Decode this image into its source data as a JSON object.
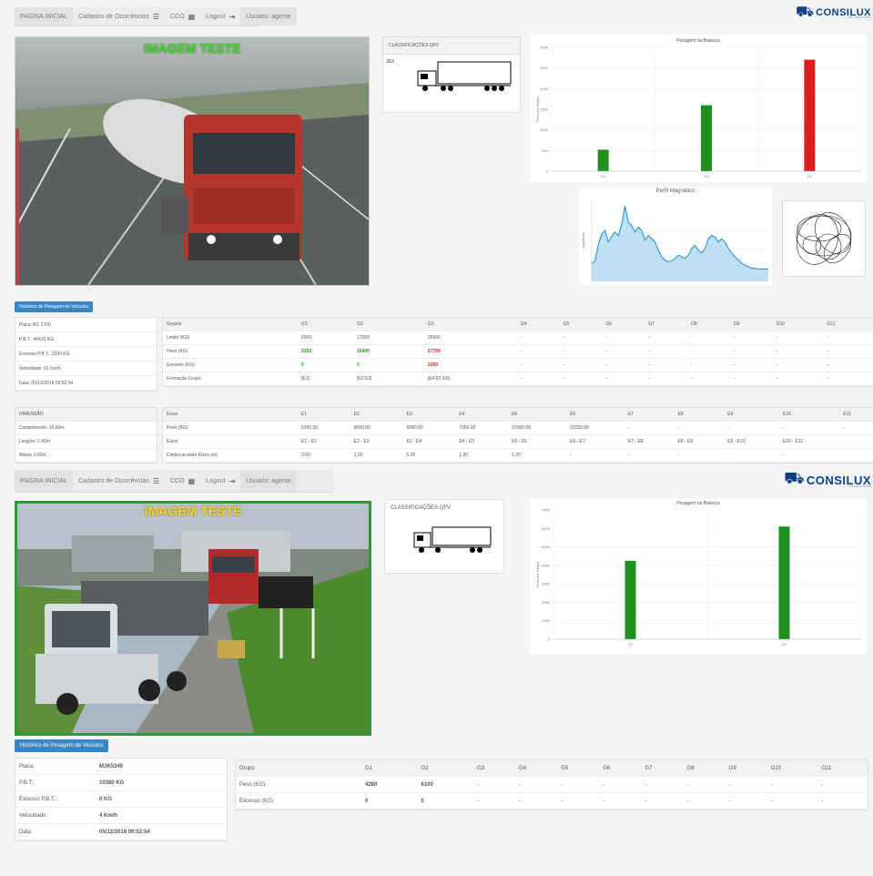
{
  "panels": [
    {
      "nav": {
        "home": "PAGINA INICIAL",
        "occurrences": "Cadastro de Ocorrências",
        "cco": "CCO",
        "logout": "Logout",
        "user": "Usuário: agente"
      },
      "logo": {
        "word": "CONSILUX",
        "tagline": "TECNOLOGIA"
      },
      "camera_title": "IMAGEM TESTE",
      "classification": {
        "label": "CLASSIFICAÇÕES QFV",
        "code": "3S3"
      },
      "weighing_chart": {
        "type": "bar",
        "title": "Pesagem na Balança",
        "ylabel": "Peso por Grupo",
        "categories": [
          "G1",
          "G2",
          "G3"
        ],
        "values": [
          520,
          1600,
          2700
        ],
        "colors": [
          "#1f8f1f",
          "#1f8f1f",
          "#e01d1d"
        ],
        "ylim": [
          0,
          3000
        ],
        "yticks": [
          "0",
          "500",
          "1000",
          "1500",
          "2000",
          "2500",
          "3000"
        ]
      },
      "magnetic_chart": {
        "type": "area",
        "title": "Perfil Magnético",
        "ylabel": "Amplitude",
        "values": [
          22,
          25,
          45,
          58,
          62,
          48,
          55,
          60,
          56,
          70,
          92,
          72,
          68,
          60,
          66,
          62,
          50,
          56,
          52,
          48,
          38,
          30,
          26,
          24,
          25,
          28,
          32,
          30,
          28,
          32,
          40,
          44,
          38,
          35,
          40,
          52,
          56,
          54,
          48,
          52,
          48,
          40,
          35,
          30,
          26,
          22,
          20,
          18,
          16,
          16,
          15,
          15,
          15,
          15
        ]
      },
      "history_button": "Histórico de Pesagem de Veículos",
      "vehicle_info": [
        "Placa: BC 1700",
        "P.B.T.: 40410 KG",
        "Excesso P.B.T.: 2200 KG",
        "Velocidade: 61 Km/h",
        "Data: 05/12/2018 09:52:34"
      ],
      "groups_table": {
        "headers": [
          "Grupos",
          "G1",
          "G2",
          "G3",
          "G4",
          "G5",
          "G6",
          "G7",
          "G8",
          "G9",
          "G10",
          "G11"
        ],
        "rows": [
          {
            "label": "Limite (KG)",
            "cells": [
              "6000",
              "17000",
              "25500",
              "-",
              "-",
              "-",
              "-",
              "-",
              "-",
              "-",
              "-"
            ]
          },
          {
            "label": "Peso (KG)",
            "cells": [
              "5250",
              "15400",
              "27700",
              "-",
              "-",
              "-",
              "-",
              "-",
              "-",
              "-",
              "-"
            ]
          },
          {
            "label": "Excesso (KG)",
            "cells": [
              "0",
              "0",
              "2200",
              "-",
              "-",
              "-",
              "-",
              "-",
              "-",
              "-",
              "-"
            ]
          },
          {
            "label": "Formação Grupo",
            "cells": [
              "[E1]",
              "[E2 E3]",
              "[E4 E5 E6]",
              "-",
              "-",
              "-",
              "-",
              "-",
              "-",
              "-",
              "-"
            ]
          }
        ]
      },
      "dimension_info": {
        "title": "DIMENSÃO",
        "rows": [
          "Comprimento: 18.60m",
          "Largura: 2.45m",
          "Altura: 3.60m"
        ]
      },
      "axles_table": {
        "headers": [
          "Eixos",
          "E1",
          "E2",
          "E3",
          "E4",
          "E5",
          "E6",
          "E7",
          "E8",
          "E9",
          "E10",
          "E11"
        ],
        "rows": [
          {
            "label": "Peso (KG)",
            "cells": [
              "5250.00",
              "9060.00",
              "6080.00",
              "7060.00",
              "10360.00",
              "10250.00",
              "-",
              "-",
              "-",
              "-",
              "-"
            ]
          },
          {
            "label": "Eixos",
            "cells": [
              "E1 - E2",
              "E2 - E3",
              "E3 - E4",
              "E4 - E5",
              "E5 - E6",
              "E6 - E7",
              "E7 - E8",
              "E8 - E9",
              "E9 - E10",
              "E10 - E11",
              ""
            ]
          },
          {
            "label": "Distância entre Eixos (m)",
            "cells": [
              "3.60",
              "1.30",
              "5.30",
              "1.20",
              "1.20",
              "-",
              "-",
              "-",
              "-",
              "-",
              ""
            ]
          }
        ]
      }
    },
    {
      "nav": {
        "home": "PAGINA INICIAL",
        "occurrences": "Cadastro de Ocorrências",
        "cco": "CCO",
        "logout": "Logout",
        "user": "Usuário: agente"
      },
      "logo": {
        "word": "CONSILUX",
        "tagline": "TECNOLOGIA"
      },
      "camera_title": "IMAGEM TESTE",
      "classification": {
        "label": "CLASSIFICAÇÕES QFV",
        "code": ""
      },
      "weighing_chart": {
        "type": "bar",
        "title": "Pesagem na Balança",
        "ylabel": "Peso por Grupo",
        "categories": [
          "G1",
          "G2"
        ],
        "values": [
          4250,
          6100
        ],
        "colors": [
          "#1f8f1f",
          "#1f8f1f"
        ],
        "ylim": [
          0,
          7000
        ],
        "yticks": [
          "0",
          "1000",
          "2000",
          "3000",
          "4000",
          "5000",
          "6000",
          "7000"
        ]
      },
      "history_button": "Histórico de Pesagem de Veículos",
      "vehicle_info": [
        {
          "label": "Placa:",
          "value": "MJK5349"
        },
        {
          "label": "P.B.T.:",
          "value": "10380 KG"
        },
        {
          "label": "Excesso P.B.T.:",
          "value": "0 KG"
        },
        {
          "label": "Velocidade:",
          "value": "4 Km/h"
        },
        {
          "label": "Data:",
          "value": "05/12/2018 09:52:54"
        }
      ],
      "groups_table": {
        "headers": [
          "Grupo",
          "G1",
          "G2",
          "G3",
          "G4",
          "G5",
          "G6",
          "G7",
          "G8",
          "G9",
          "G10",
          "G11"
        ],
        "rows": [
          {
            "label": "Peso (KG)",
            "cells": [
              "4280",
              "6100",
              "-",
              "-",
              "-",
              "-",
              "-",
              "-",
              "-",
              "-",
              "-"
            ]
          },
          {
            "label": "Excesso (KG)",
            "cells": [
              "0",
              "0",
              "-",
              "-",
              "-",
              "-",
              "-",
              "-",
              "-",
              "-",
              "-"
            ]
          }
        ]
      }
    }
  ]
}
